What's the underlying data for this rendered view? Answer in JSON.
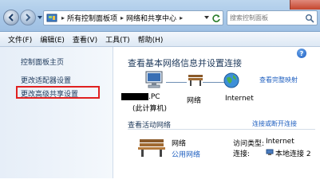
{
  "address": {
    "crumbs": [
      "所有控制面板项",
      "网络和共享中心"
    ],
    "search_placeholder": "搜索控制面板"
  },
  "menu": [
    "文件(F)",
    "编辑(E)",
    "查看(V)",
    "工具(T)",
    "帮助(H)"
  ],
  "sidebar": {
    "items": [
      {
        "label": "控制面板主页"
      },
      {
        "label": "更改适配器设置"
      },
      {
        "label": "更改高级共享设置"
      }
    ]
  },
  "main": {
    "title": "查看基本网络信息并设置连接",
    "view_full_map": "查看完整映射",
    "nodes": {
      "pc_name": ".PC",
      "pc_sub": "(此计算机)",
      "network": "网络",
      "internet": "Internet"
    },
    "active_title": "查看活动网络",
    "connect_disconnect": "连接或断开连接",
    "active_network": {
      "name": "网络",
      "type": "公用网络",
      "access_type_label": "访问类型:",
      "access_type_value": "Internet",
      "connection_label": "连接:",
      "connection_value": "本地连接 2"
    }
  },
  "colors": {
    "link": "#2060c0",
    "highlight": "#e02020"
  }
}
